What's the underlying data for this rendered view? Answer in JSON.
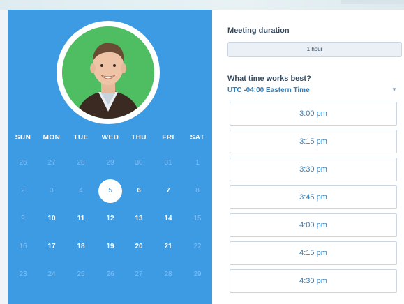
{
  "calendar": {
    "weekdays": [
      "SUN",
      "MON",
      "TUE",
      "WED",
      "THU",
      "FRI",
      "SAT"
    ],
    "weeks": [
      [
        {
          "d": "26",
          "s": "muted"
        },
        {
          "d": "27",
          "s": "muted"
        },
        {
          "d": "28",
          "s": "muted"
        },
        {
          "d": "29",
          "s": "muted"
        },
        {
          "d": "30",
          "s": "muted"
        },
        {
          "d": "31",
          "s": "muted"
        },
        {
          "d": "1",
          "s": "muted"
        }
      ],
      [
        {
          "d": "2",
          "s": "muted"
        },
        {
          "d": "3",
          "s": "muted"
        },
        {
          "d": "4",
          "s": "muted"
        },
        {
          "d": "5",
          "s": "selected"
        },
        {
          "d": "6",
          "s": "active"
        },
        {
          "d": "7",
          "s": "active"
        },
        {
          "d": "8",
          "s": "muted"
        }
      ],
      [
        {
          "d": "9",
          "s": "muted"
        },
        {
          "d": "10",
          "s": "active"
        },
        {
          "d": "11",
          "s": "active"
        },
        {
          "d": "12",
          "s": "active"
        },
        {
          "d": "13",
          "s": "active"
        },
        {
          "d": "14",
          "s": "active"
        },
        {
          "d": "15",
          "s": "muted"
        }
      ],
      [
        {
          "d": "16",
          "s": "muted"
        },
        {
          "d": "17",
          "s": "active"
        },
        {
          "d": "18",
          "s": "active"
        },
        {
          "d": "19",
          "s": "active"
        },
        {
          "d": "20",
          "s": "active"
        },
        {
          "d": "21",
          "s": "active"
        },
        {
          "d": "22",
          "s": "muted"
        }
      ],
      [
        {
          "d": "23",
          "s": "muted"
        },
        {
          "d": "24",
          "s": "muted"
        },
        {
          "d": "25",
          "s": "muted"
        },
        {
          "d": "26",
          "s": "muted"
        },
        {
          "d": "27",
          "s": "muted"
        },
        {
          "d": "28",
          "s": "muted"
        },
        {
          "d": "29",
          "s": "muted"
        }
      ]
    ]
  },
  "meeting": {
    "duration_label": "Meeting duration",
    "duration_value": "1 hour",
    "time_question": "What time works best?",
    "timezone": "UTC -04:00 Eastern Time"
  },
  "slots": [
    "3:00 pm",
    "3:15 pm",
    "3:30 pm",
    "3:45 pm",
    "4:00 pm",
    "4:15 pm",
    "4:30 pm"
  ],
  "colors": {
    "panel_blue": "#3d9be4",
    "link_blue": "#2e7fbf",
    "avatar_bg": "#4fbe63"
  }
}
